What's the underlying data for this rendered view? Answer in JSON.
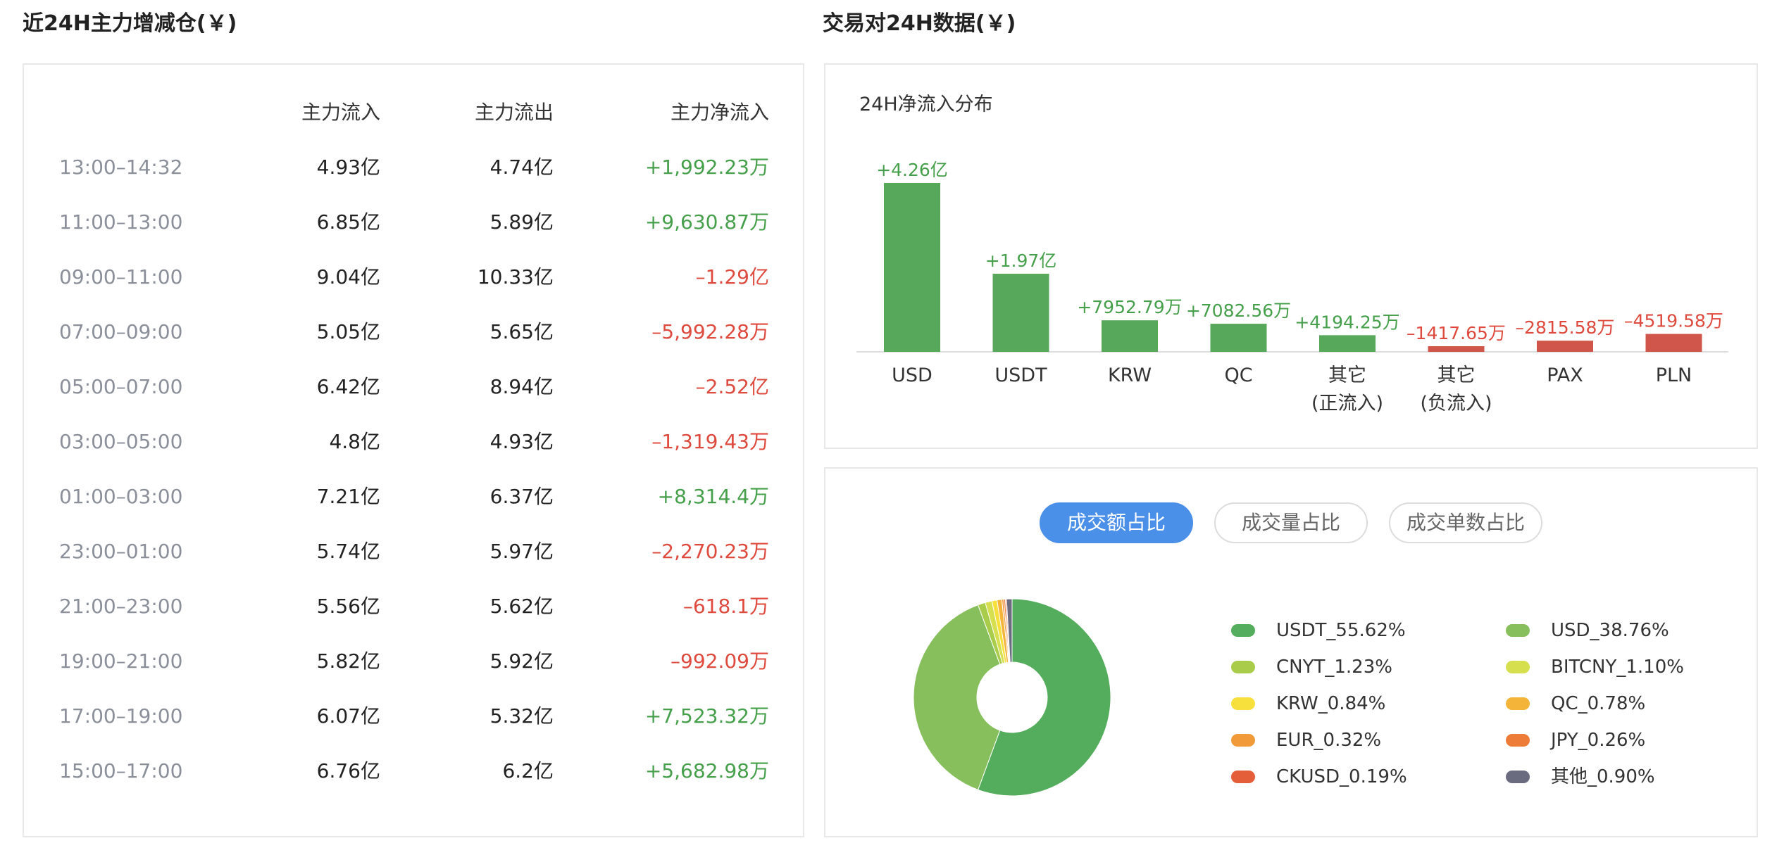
{
  "left": {
    "title": "近24H主力增减仓(￥)",
    "headers": {
      "inflow": "主力流入",
      "outflow": "主力流出",
      "net": "主力净流入"
    },
    "rows": [
      {
        "time": "13:00–14:32",
        "inflow": "4.93亿",
        "outflow": "4.74亿",
        "net": "+1,992.23万",
        "sign": "pos"
      },
      {
        "time": "11:00–13:00",
        "inflow": "6.85亿",
        "outflow": "5.89亿",
        "net": "+9,630.87万",
        "sign": "pos"
      },
      {
        "time": "09:00–11:00",
        "inflow": "9.04亿",
        "outflow": "10.33亿",
        "net": "–1.29亿",
        "sign": "neg"
      },
      {
        "time": "07:00–09:00",
        "inflow": "5.05亿",
        "outflow": "5.65亿",
        "net": "–5,992.28万",
        "sign": "neg"
      },
      {
        "time": "05:00–07:00",
        "inflow": "6.42亿",
        "outflow": "8.94亿",
        "net": "–2.52亿",
        "sign": "neg"
      },
      {
        "time": "03:00–05:00",
        "inflow": "4.8亿",
        "outflow": "4.93亿",
        "net": "–1,319.43万",
        "sign": "neg"
      },
      {
        "time": "01:00–03:00",
        "inflow": "7.21亿",
        "outflow": "6.37亿",
        "net": "+8,314.4万",
        "sign": "pos"
      },
      {
        "time": "23:00–01:00",
        "inflow": "5.74亿",
        "outflow": "5.97亿",
        "net": "–2,270.23万",
        "sign": "neg"
      },
      {
        "time": "21:00–23:00",
        "inflow": "5.56亿",
        "outflow": "5.62亿",
        "net": "–618.1万",
        "sign": "neg"
      },
      {
        "time": "19:00–21:00",
        "inflow": "5.82亿",
        "outflow": "5.92亿",
        "net": "–992.09万",
        "sign": "neg"
      },
      {
        "time": "17:00–19:00",
        "inflow": "6.07亿",
        "outflow": "5.32亿",
        "net": "+7,523.32万",
        "sign": "pos"
      },
      {
        "time": "15:00–17:00",
        "inflow": "6.76亿",
        "outflow": "6.2亿",
        "net": "+5,682.98万",
        "sign": "pos"
      }
    ]
  },
  "right": {
    "title": "交易对24H数据(￥)",
    "bar_title": "24H净流入分布",
    "tabs": [
      "成交额占比",
      "成交量占比",
      "成交单数占比"
    ]
  },
  "colors": {
    "positive": "#46a04b",
    "negative": "#df4a3e",
    "bar_positive": "#57a85a",
    "bar_negative": "#d0554b",
    "tab_active": "#4a8fe8"
  },
  "chart_data": [
    {
      "type": "bar",
      "title": "24H净流入分布",
      "categories": [
        "USD",
        "USDT",
        "KRW",
        "QC",
        "其它\n(正流入)",
        "其它\n(负流入)",
        "PAX",
        "PLN"
      ],
      "values": [
        42600,
        19700,
        7952.79,
        7082.56,
        4194.25,
        -1417.65,
        -2815.58,
        -4519.58
      ],
      "value_labels": [
        "+4.26亿",
        "+1.97亿",
        "+7952.79万",
        "+7082.56万",
        "+4194.25万",
        "–1417.65万",
        "–2815.58万",
        "–4519.58万"
      ],
      "unit": "万",
      "note_display": "negative values drawn upward in red",
      "grid": false
    },
    {
      "type": "pie",
      "donut": true,
      "labels": [
        "USDT",
        "USD",
        "CNYT",
        "BITCNY",
        "KRW",
        "QC",
        "EUR",
        "JPY",
        "CKUSD",
        "其他"
      ],
      "legend": [
        "USDT_55.62%",
        "USD_38.76%",
        "CNYT_1.23%",
        "BITCNY_1.10%",
        "KRW_0.84%",
        "QC_0.78%",
        "EUR_0.32%",
        "JPY_0.26%",
        "CKUSD_0.19%",
        "其他_0.90%"
      ],
      "values": [
        55.62,
        38.76,
        1.23,
        1.1,
        0.84,
        0.78,
        0.32,
        0.26,
        0.19,
        0.9
      ],
      "colors": [
        "#54ad5c",
        "#86bf5c",
        "#a9cc4a",
        "#d6df4d",
        "#f8e03c",
        "#f4b43a",
        "#f09a3a",
        "#ec7c38",
        "#e45e3a",
        "#6b6b80"
      ],
      "legend_position": "right"
    }
  ]
}
